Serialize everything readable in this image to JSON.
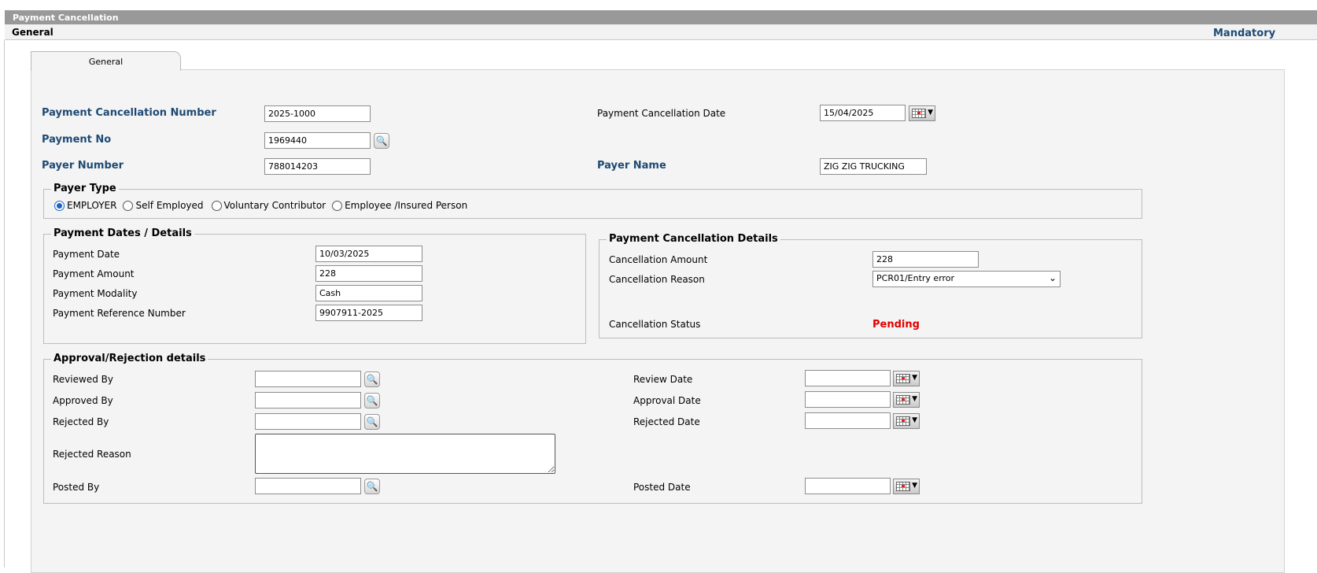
{
  "window": {
    "title": "Payment Cancellation"
  },
  "header": {
    "section": "General",
    "mandatory": "Mandatory"
  },
  "tabs": [
    {
      "label": "General"
    }
  ],
  "main": {
    "cancellation_number": {
      "label": "Payment Cancellation Number",
      "value": "2025-1000"
    },
    "cancellation_date": {
      "label": "Payment Cancellation Date",
      "value": "15/04/2025",
      "icon": "calendar-icon"
    },
    "payment_no": {
      "label": "Payment No",
      "value": "1969440",
      "icon": "search-icon"
    },
    "payer_number": {
      "label": "Payer Number",
      "value": "788014203"
    },
    "payer_name": {
      "label": "Payer Name",
      "value": "ZIG ZIG TRUCKING"
    }
  },
  "payer_type": {
    "legend": "Payer Type",
    "options": [
      "EMPLOYER",
      "Self Employed",
      "Voluntary Contributor",
      "Employee /Insured Person"
    ],
    "selected": "EMPLOYER"
  },
  "payment_details": {
    "legend": "Payment Dates / Details",
    "fields": [
      {
        "label": "Payment Date",
        "value": "10/03/2025"
      },
      {
        "label": "Payment Amount",
        "value": "228"
      },
      {
        "label": "Payment Modality",
        "value": "Cash"
      },
      {
        "label": "Payment Reference Number",
        "value": "9907911-2025"
      }
    ]
  },
  "cancellation_details": {
    "legend": "Payment Cancellation Details",
    "amount": {
      "label": "Cancellation Amount",
      "value": "228"
    },
    "reason": {
      "label": "Cancellation Reason",
      "value": "PCR01/Entry error"
    },
    "status": {
      "label": "Cancellation Status",
      "value": "Pending",
      "color": "#e00000"
    }
  },
  "approval": {
    "legend": "Approval/Rejection details",
    "reviewed_by": {
      "label": "Reviewed By",
      "value": ""
    },
    "approved_by": {
      "label": "Approved By",
      "value": ""
    },
    "rejected_by": {
      "label": "Rejected By",
      "value": ""
    },
    "rejected_reason": {
      "label": "Rejected Reason",
      "value": ""
    },
    "posted_by": {
      "label": "Posted By",
      "value": ""
    },
    "review_date": {
      "label": "Review Date",
      "value": ""
    },
    "approval_date": {
      "label": "Approval Date",
      "value": ""
    },
    "rejected_date": {
      "label": "Rejected Date",
      "value": ""
    },
    "posted_date": {
      "label": "Posted Date",
      "value": ""
    }
  },
  "colors": {
    "label_blue": "#1d4a74",
    "titlebar": "#999999",
    "panel": "#f4f4f4",
    "radio_selected": "#1a64c8"
  }
}
